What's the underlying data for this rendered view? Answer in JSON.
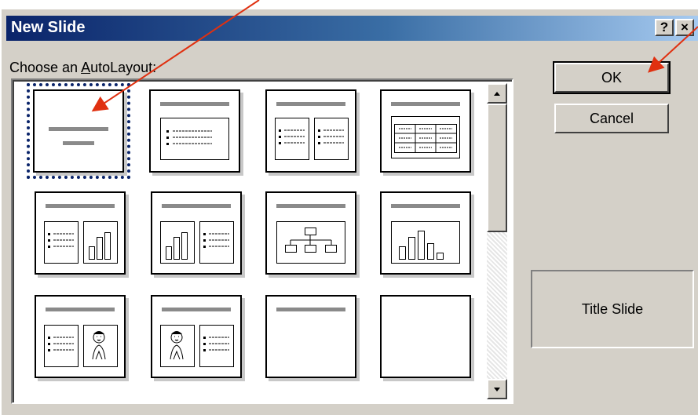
{
  "dialog": {
    "title": "New Slide",
    "help_label": "?",
    "close_label": "×",
    "prompt_before": "Choose an ",
    "prompt_accel": "A",
    "prompt_after": "utoLayout:",
    "ok_label": "OK",
    "cancel_label": "Cancel",
    "preview_label": "Title Slide"
  },
  "layouts": [
    {
      "name": "title-slide",
      "selected": true
    },
    {
      "name": "bulleted-list"
    },
    {
      "name": "two-column-text"
    },
    {
      "name": "table"
    },
    {
      "name": "text-and-chart"
    },
    {
      "name": "chart-and-text"
    },
    {
      "name": "organization-chart"
    },
    {
      "name": "chart"
    },
    {
      "name": "text-and-clip-art"
    },
    {
      "name": "clip-art-and-text"
    },
    {
      "name": "title-only"
    },
    {
      "name": "blank"
    }
  ],
  "annotation_color": "#e03010",
  "selection_color": "#0a246a",
  "icons": [
    "help-icon",
    "close-icon",
    "scroll-up-icon",
    "scroll-down-icon",
    "annotation-arrow-icon"
  ]
}
